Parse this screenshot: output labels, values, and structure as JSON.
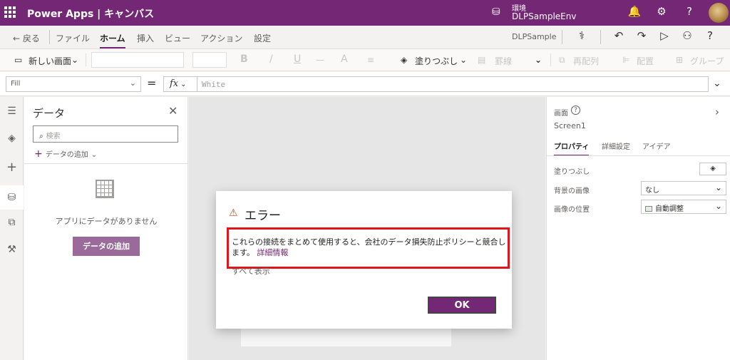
{
  "app": {
    "title": "Power Apps | キャンバス",
    "env_label": "環境",
    "env_name": "DLPSampleEnv"
  },
  "menu": {
    "back": "← 戻る",
    "items": [
      "ファイル",
      "ホーム",
      "挿入",
      "ビュー",
      "アクション",
      "設定"
    ],
    "active": "ホーム",
    "app_name": "DLPSample"
  },
  "ribbon": {
    "new_screen": "新しい画面",
    "bold": "B",
    "italic": "/",
    "underline": "U",
    "strike": "—",
    "font": "A",
    "fill": "塗りつぶし",
    "border": "罫線",
    "reorder": "再配列",
    "align": "配置",
    "group": "グループ"
  },
  "formula": {
    "property": "Fill",
    "fx": "fx",
    "value": "White"
  },
  "data_panel": {
    "title": "データ",
    "search_placeholder": "検索",
    "add_data_link": "データの追加",
    "empty_text": "アプリにデータがありません",
    "add_data_button": "データの追加"
  },
  "properties": {
    "type_label": "画面",
    "screen_name": "Screen1",
    "tabs": [
      "プロパティ",
      "詳細設定",
      "アイデア"
    ],
    "active_tab": "プロパティ",
    "fill_label": "塗りつぶし",
    "bg_image_label": "背景の画像",
    "bg_image_value": "なし",
    "image_position_label": "画像の位置",
    "image_position_value": "自動調整"
  },
  "dialog": {
    "title": "エラー",
    "message": "これらの接続をまとめて使用すると、会社のデータ損失防止ポリシーと競合します。",
    "link": "詳細情報",
    "show_all": "すべて表示",
    "ok": "OK"
  },
  "colors": {
    "brand": "#742774",
    "highlight": "#e0151c",
    "warning": "#c4501b"
  }
}
